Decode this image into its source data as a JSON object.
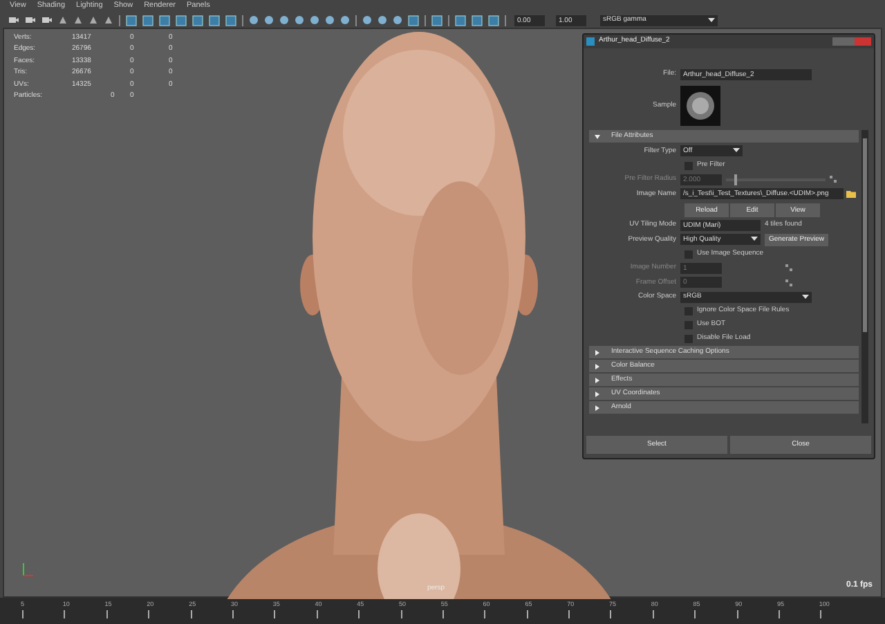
{
  "menu": [
    "View",
    "Shading",
    "Lighting",
    "Show",
    "Renderer",
    "Panels"
  ],
  "toolbar": {
    "fields": [
      "0.00",
      "1.00"
    ],
    "color_space": "sRGB gamma"
  },
  "hud": [
    {
      "label": "Verts:",
      "values": [
        "13417",
        "0",
        "0"
      ],
      "kind": "mesh"
    },
    {
      "label": "Edges:",
      "values": [
        "26796",
        "0",
        "0"
      ],
      "kind": "mesh"
    },
    {
      "label": "Faces:",
      "values": [
        "13338",
        "0",
        "0"
      ],
      "kind": "mesh"
    },
    {
      "label": "Tris:",
      "values": [
        "26676",
        "0",
        "0"
      ],
      "kind": "mesh"
    },
    {
      "label": "UVs:",
      "values": [
        "14325",
        "0",
        "0"
      ],
      "kind": "mesh"
    },
    {
      "label": "Particles:",
      "values": [
        "0",
        "0"
      ],
      "kind": "count"
    }
  ],
  "viewport": {
    "camera": "persp",
    "fps": "0.1 fps"
  },
  "timeline": {
    "ticks": [
      "5",
      "10",
      "15",
      "20",
      "25",
      "30",
      "35",
      "40",
      "45",
      "50",
      "55",
      "60",
      "65",
      "70",
      "75",
      "80",
      "85",
      "90",
      "95",
      "100"
    ]
  },
  "window": {
    "title": "Arthur_head_Diffuse_2",
    "file_label": "File:",
    "file": "Arthur_head_Diffuse_2",
    "sample_label": "Sample",
    "sections": [
      {
        "title": "File Attributes",
        "expanded": true,
        "attributes": [
          {
            "kind": "dropdown",
            "label": "Filter Type",
            "value": "Off",
            "disabled": false
          },
          {
            "kind": "checkbox",
            "label": "Pre Filter",
            "checked": false,
            "disabled": false
          },
          {
            "kind": "slider",
            "label": "Pre Filter Radius",
            "value": "2.000",
            "level": 0.08,
            "disabled": true
          },
          {
            "kind": "path",
            "label": "Image Name",
            "value": "/s_i_Test\\i_Test_Textures\\_Diffuse.<UDIM>.png",
            "disabled": false
          },
          {
            "kind": "buttons",
            "buttons": [
              "Reload",
              "Edit",
              "View"
            ]
          },
          {
            "kind": "text",
            "label": "UV Tiling Mode",
            "value": "UDIM (Mari)",
            "note": "4 tiles found",
            "disabled": false
          },
          {
            "kind": "dropdown",
            "label": "Preview Quality",
            "value": "High Quality",
            "button": "Generate Preview",
            "disabled": false
          },
          {
            "kind": "checkbox",
            "label": "Use Image Sequence",
            "checked": false,
            "disabled": false
          },
          {
            "kind": "number",
            "label": "Image Number",
            "value": "1",
            "disabled": true
          },
          {
            "kind": "number",
            "label": "Frame Offset",
            "value": "0",
            "disabled": true
          },
          {
            "kind": "colorspace",
            "label": "Color Space",
            "value": "sRGB",
            "disabled": false
          },
          {
            "kind": "checkbox",
            "label": "Ignore Color Space File Rules",
            "checked": false,
            "disabled": false
          },
          {
            "kind": "checkbox",
            "label": "Use BOT",
            "checked": false,
            "disabled": false
          },
          {
            "kind": "checkbox",
            "label": "Disable File Load",
            "checked": false,
            "disabled": false
          }
        ]
      },
      {
        "title": "Interactive Sequence Caching Options",
        "expanded": false
      },
      {
        "title": "Color Balance",
        "expanded": false
      },
      {
        "title": "Effects",
        "expanded": false
      },
      {
        "title": "UV Coordinates",
        "expanded": false
      },
      {
        "title": "Arnold",
        "expanded": false
      }
    ],
    "buttons": [
      "Select",
      "Close"
    ]
  }
}
